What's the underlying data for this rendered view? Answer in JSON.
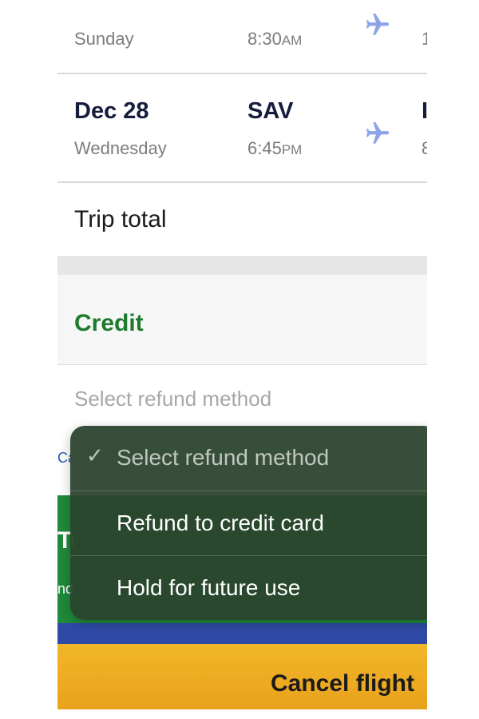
{
  "flights": [
    {
      "date": "",
      "day": "Sunday",
      "code": "",
      "time": "8:30",
      "ampm": "AM",
      "cut_main": "",
      "cut_sub": "1"
    },
    {
      "date": "Dec 28",
      "day": "Wednesday",
      "code": "SAV",
      "time": "6:45",
      "ampm": "PM",
      "cut_main": "I",
      "cut_sub": "8"
    }
  ],
  "trip_total_label": "Trip total",
  "credit_label": "Credit",
  "refund_select": {
    "placeholder": "Select refund method"
  },
  "dropdown": {
    "items": [
      {
        "label": "Select refund method",
        "check": "✓",
        "selected": true
      },
      {
        "label": "Refund to credit card",
        "check": "",
        "selected": false
      },
      {
        "label": "Hold for future use",
        "check": "",
        "selected": false
      }
    ]
  },
  "behind": {
    "link_fragment": "Ca",
    "green_title_fragment": "To",
    "green_sub_fragment": "nd"
  },
  "cancel_button_label": "Cancel flight",
  "colors": {
    "navy_text": "#151c3c",
    "credit_green": "#1f7a2b",
    "plane_blue": "#8da4e8",
    "cancel_yellow": "#f2b62a",
    "bar_blue": "#2f4aa6",
    "dropdown_bg": "#2a442e"
  },
  "icons": {
    "flight": "airplane-icon",
    "selected": "checkmark-icon"
  }
}
